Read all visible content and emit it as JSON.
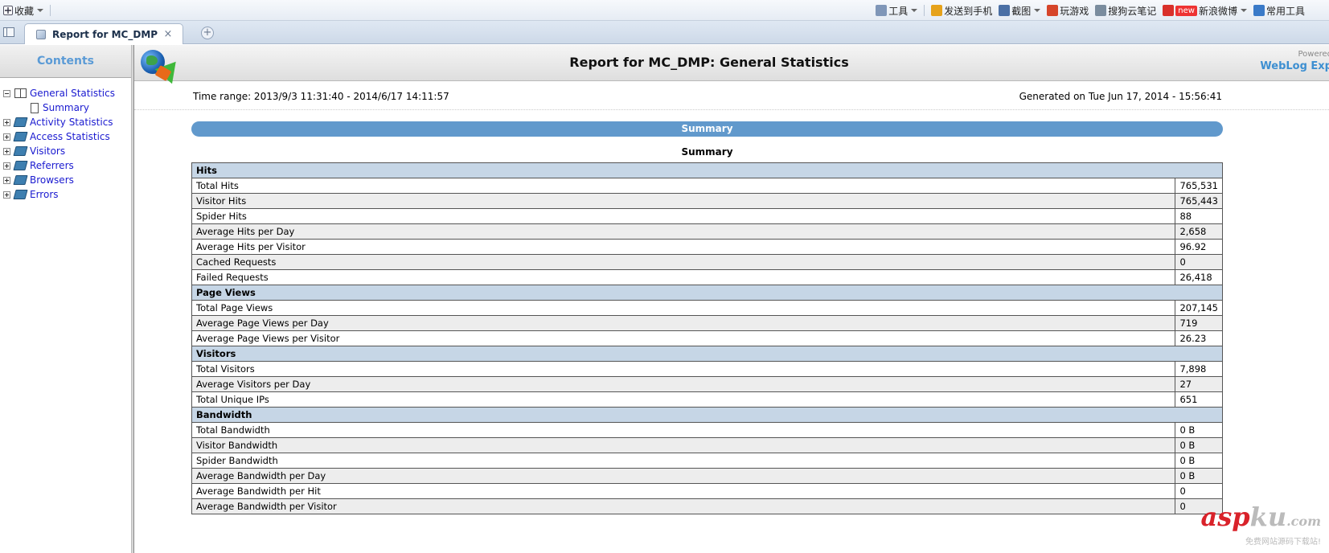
{
  "browser": {
    "favorites_label": "收藏",
    "toolbar": [
      {
        "label": "工具",
        "icon": "toolbox-icon",
        "dropdown": true
      },
      {
        "label": "发送到手机",
        "icon": "send-to-phone-icon",
        "dropdown": false
      },
      {
        "label": "截图",
        "icon": "screenshot-icon",
        "dropdown": true
      },
      {
        "label": "玩游戏",
        "icon": "game-icon",
        "dropdown": false
      },
      {
        "label": "搜狗云笔记",
        "icon": "cloud-note-icon",
        "dropdown": false
      },
      {
        "label": "新浪微博",
        "icon": "weibo-icon",
        "dropdown": true,
        "badge": "new"
      },
      {
        "label": "常用工具",
        "icon": "common-tools-icon",
        "dropdown": false
      }
    ],
    "tab": {
      "title": "Report for MC_DMP",
      "close": "×"
    },
    "new_tab": "+"
  },
  "sidebar": {
    "title": "Contents",
    "items": [
      {
        "label": "General Statistics",
        "expanded": true,
        "children": [
          {
            "label": "Summary"
          }
        ]
      },
      {
        "label": "Activity Statistics",
        "expanded": false
      },
      {
        "label": "Access Statistics",
        "expanded": false
      },
      {
        "label": "Visitors",
        "expanded": false
      },
      {
        "label": "Referrers",
        "expanded": false
      },
      {
        "label": "Browsers",
        "expanded": false
      },
      {
        "label": "Errors",
        "expanded": false
      }
    ]
  },
  "report": {
    "title": "Report for MC_DMP: General Statistics",
    "powered_by": "Powered",
    "brand": "WebLog Exp",
    "time_range": "Time range: 2013/9/3 11:31:40 - 2014/6/17 14:11:57",
    "generated": "Generated on Tue Jun 17, 2014 - 15:56:41",
    "section_title": "Summary",
    "table_caption": "Summary",
    "groups": [
      {
        "name": "Hits",
        "rows": [
          {
            "label": "Total Hits",
            "value": "765,531"
          },
          {
            "label": "Visitor Hits",
            "value": "765,443"
          },
          {
            "label": "Spider Hits",
            "value": "88"
          },
          {
            "label": "Average Hits per Day",
            "value": "2,658"
          },
          {
            "label": "Average Hits per Visitor",
            "value": "96.92"
          },
          {
            "label": "Cached Requests",
            "value": "0"
          },
          {
            "label": "Failed Requests",
            "value": "26,418"
          }
        ]
      },
      {
        "name": "Page Views",
        "rows": [
          {
            "label": "Total Page Views",
            "value": "207,145"
          },
          {
            "label": "Average Page Views per Day",
            "value": "719"
          },
          {
            "label": "Average Page Views per Visitor",
            "value": "26.23"
          }
        ]
      },
      {
        "name": "Visitors",
        "rows": [
          {
            "label": "Total Visitors",
            "value": "7,898"
          },
          {
            "label": "Average Visitors per Day",
            "value": "27"
          },
          {
            "label": "Total Unique IPs",
            "value": "651"
          }
        ]
      },
      {
        "name": "Bandwidth",
        "rows": [
          {
            "label": "Total Bandwidth",
            "value": "0 B"
          },
          {
            "label": "Visitor Bandwidth",
            "value": "0 B"
          },
          {
            "label": "Spider Bandwidth",
            "value": "0 B"
          },
          {
            "label": "Average Bandwidth per Day",
            "value": "0 B"
          },
          {
            "label": "Average Bandwidth per Hit",
            "value": "0"
          },
          {
            "label": "Average Bandwidth per Visitor",
            "value": "0"
          }
        ]
      }
    ]
  },
  "watermark": {
    "main": "asp",
    "ku": "ku",
    "com": ".com",
    "sub": "免费网站源码下载站!"
  }
}
